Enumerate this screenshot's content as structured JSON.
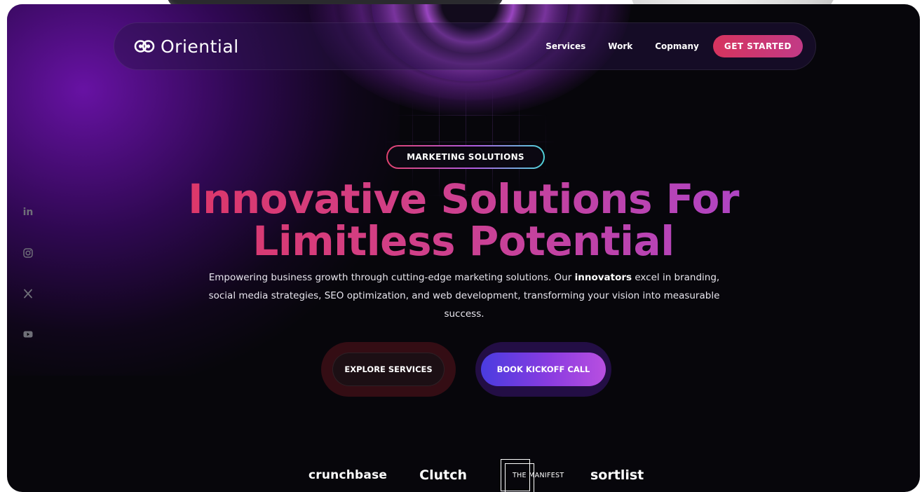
{
  "brand": {
    "name": "Oriential",
    "accent_pink": "#d6345e",
    "accent_purple": "#a446d8",
    "background": "#07060b"
  },
  "nav": {
    "links": [
      "Services",
      "Work",
      "Copmany"
    ],
    "cta": "GET STARTED"
  },
  "social": {
    "icons": [
      "linkedin-icon",
      "instagram-icon",
      "x-icon",
      "youtube-icon"
    ],
    "linkedin_label": "in"
  },
  "hero": {
    "badge": "MARKETING SOLUTIONS",
    "headline_line1": "Innovative Solutions For",
    "headline_line2": "Limitless Potential",
    "sub_part1": "Empowering business growth through cutting-edge marketing solutions. Our ",
    "sub_bold": "innovators",
    "sub_part2": " excel in branding, social media strategies, SEO optimization, and web development, transforming your vision into measurable success.",
    "cta_primary": "EXPLORE SERVICES",
    "cta_secondary": "BOOK KICKOFF CALL"
  },
  "partners": {
    "crunchbase": "crunchbase",
    "clutch": "Clutch",
    "manifest": "THE MANIFEST",
    "sortlist": "sortlist"
  }
}
